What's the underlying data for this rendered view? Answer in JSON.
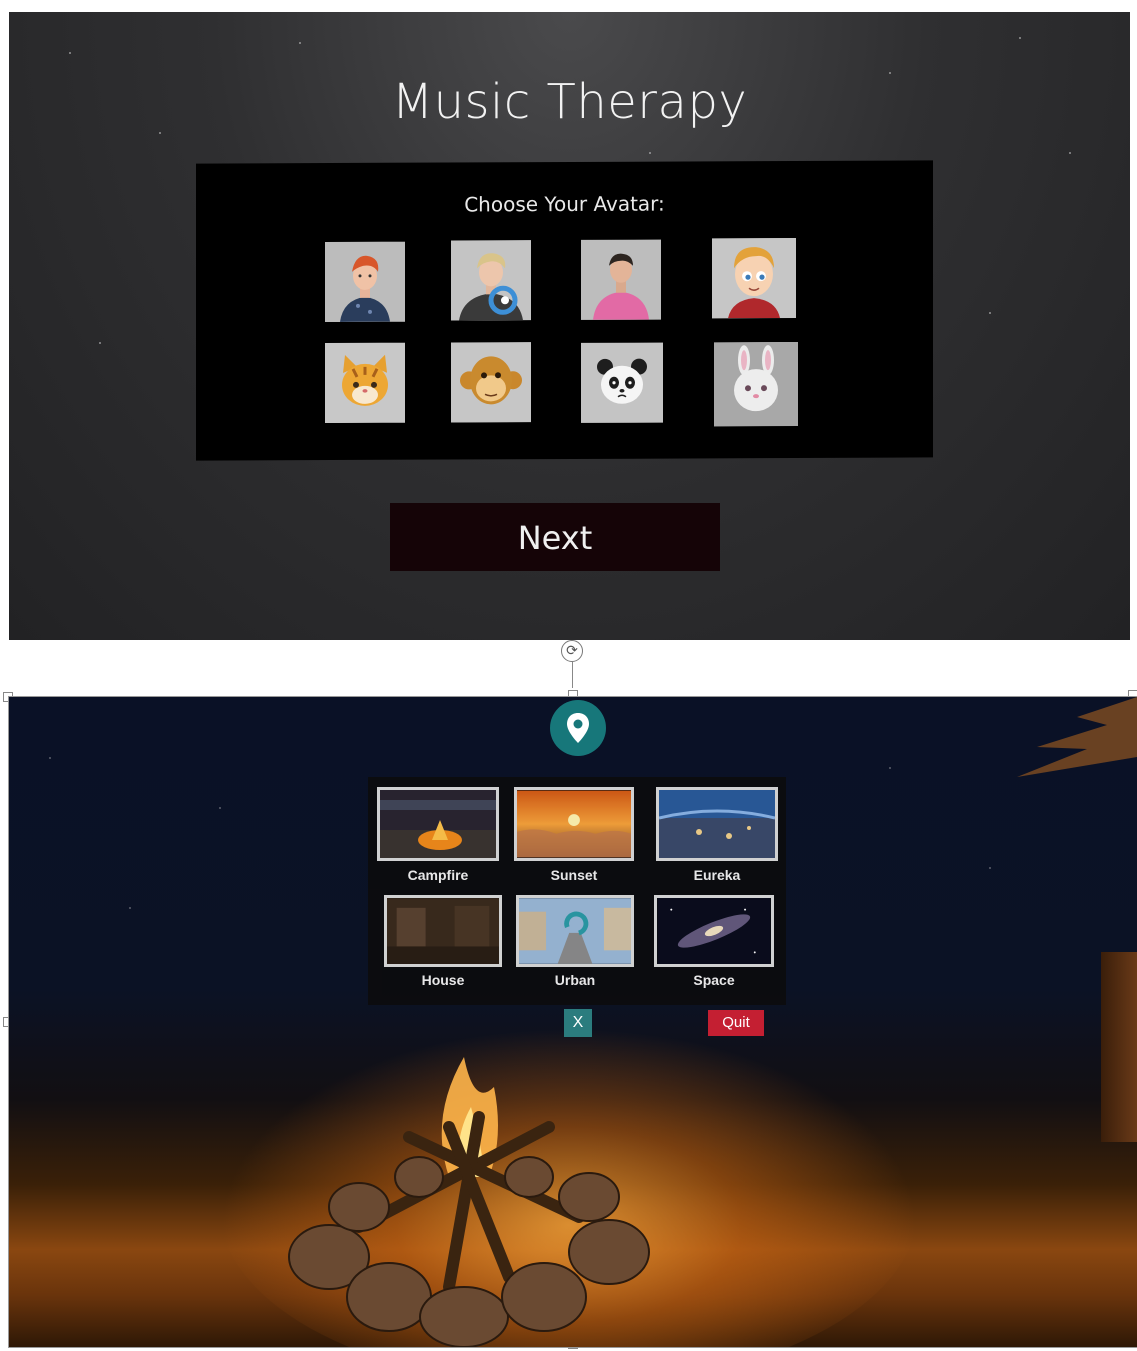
{
  "avatar_screen": {
    "title": "Music Therapy",
    "avatar_heading": "Choose Your Avatar:",
    "avatars": [
      {
        "name": "red-haired boy",
        "icon": "avatar-red-hair-boy"
      },
      {
        "name": "blond man",
        "icon": "avatar-blond-man"
      },
      {
        "name": "man in pink",
        "icon": "avatar-man-pink-shirt"
      },
      {
        "name": "cartoon boy",
        "icon": "avatar-cartoon-boy"
      },
      {
        "name": "cat",
        "icon": "avatar-cat"
      },
      {
        "name": "monkey",
        "icon": "avatar-monkey"
      },
      {
        "name": "panda",
        "icon": "avatar-panda"
      },
      {
        "name": "bunny",
        "icon": "avatar-bunny"
      }
    ],
    "next_label": "Next"
  },
  "environment_screen": {
    "environments": [
      {
        "label": "Campfire"
      },
      {
        "label": "Sunset"
      },
      {
        "label": "Eureka"
      },
      {
        "label": "House"
      },
      {
        "label": "Urban"
      },
      {
        "label": "Space"
      }
    ],
    "close_label": "X",
    "quit_label": "Quit"
  },
  "colors": {
    "teal": "#17777a",
    "quit_red": "#c41f32",
    "next_bg": "#150407"
  }
}
